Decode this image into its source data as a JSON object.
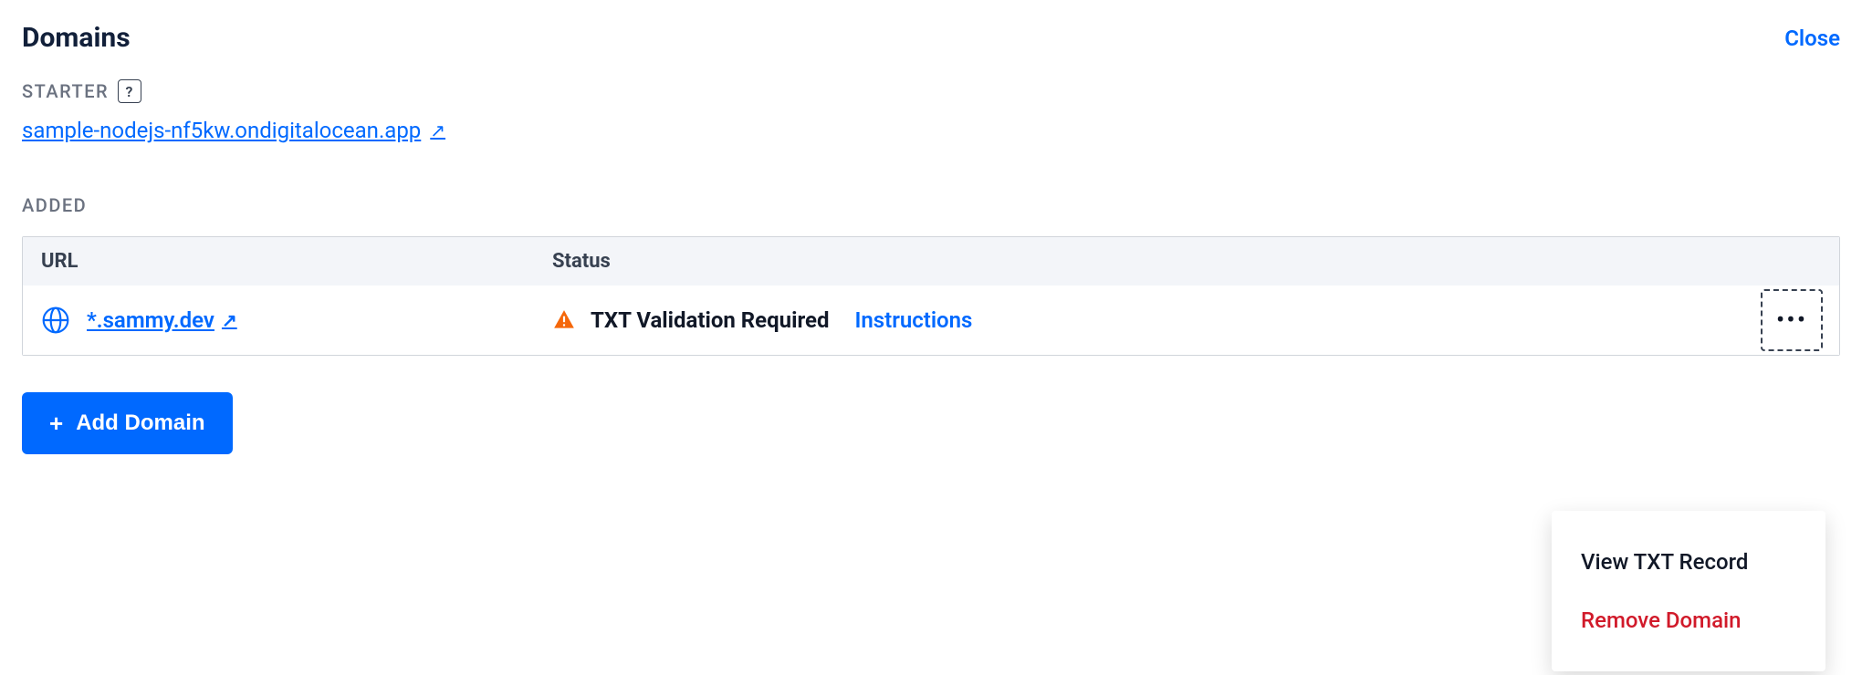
{
  "header": {
    "title": "Domains",
    "close_label": "Close"
  },
  "starter": {
    "label": "STARTER",
    "help_glyph": "?",
    "domain_url": "sample-nodejs-nf5kw.ondigitalocean.app"
  },
  "added": {
    "label": "ADDED",
    "columns": {
      "url": "URL",
      "status": "Status"
    },
    "rows": [
      {
        "domain": "*.sammy.dev",
        "status_text": "TXT Validation Required",
        "instructions_label": "Instructions"
      }
    ]
  },
  "actions": {
    "add_domain": "Add Domain"
  },
  "menu": {
    "view_txt": "View TXT Record",
    "remove_domain": "Remove Domain"
  }
}
